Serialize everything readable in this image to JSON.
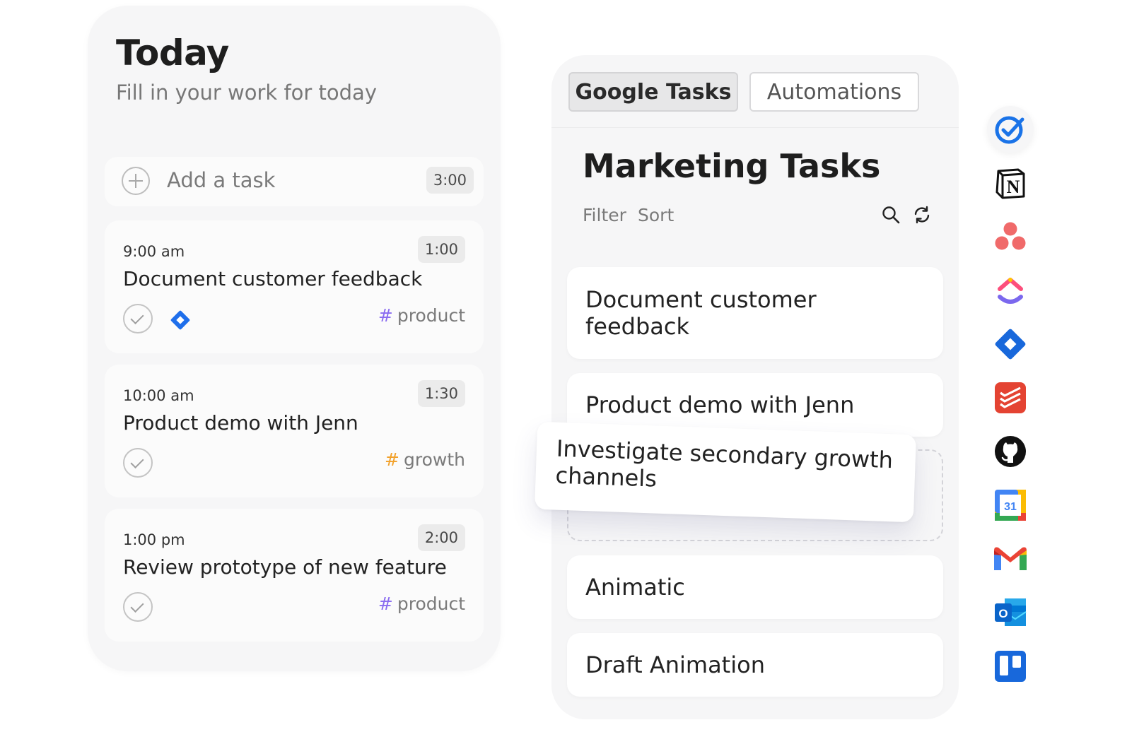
{
  "today": {
    "title": "Today",
    "subtitle": "Fill in your work for today",
    "add_task": {
      "label": "Add a task",
      "duration": "3:00"
    },
    "tasks": [
      {
        "time": "9:00 am",
        "duration": "1:00",
        "title": "Document customer feedback",
        "tag": "product",
        "tag_color": "#8a6cf0",
        "has_jira": true
      },
      {
        "time": "10:00 am",
        "duration": "1:30",
        "title": "Product demo with Jenn",
        "tag": "growth",
        "tag_color": "#f2a12a",
        "has_jira": false
      },
      {
        "time": "1:00 pm",
        "duration": "2:00",
        "title": "Review prototype of new feature",
        "tag": "product",
        "tag_color": "#8a6cf0",
        "has_jira": false
      }
    ]
  },
  "tasks_panel": {
    "tabs": [
      "Google Tasks",
      "Automations"
    ],
    "active_tab": "Google Tasks",
    "title": "Marketing Tasks",
    "filter_label": "Filter",
    "sort_label": "Sort",
    "items": [
      "Document customer feedback",
      "Product demo with Jenn",
      "Animatic",
      "Draft Animation"
    ],
    "dragging_item": "Investigate secondary growth channels"
  },
  "integrations": [
    "google-tasks-icon",
    "notion-icon",
    "asana-icon",
    "clickup-icon",
    "jira-icon",
    "todoist-icon",
    "github-icon",
    "google-calendar-icon",
    "gmail-icon",
    "outlook-icon",
    "trello-icon"
  ],
  "calendar_day": "31",
  "outlook_letter": "O",
  "notion_letter": "N",
  "hash_symbol": "#"
}
